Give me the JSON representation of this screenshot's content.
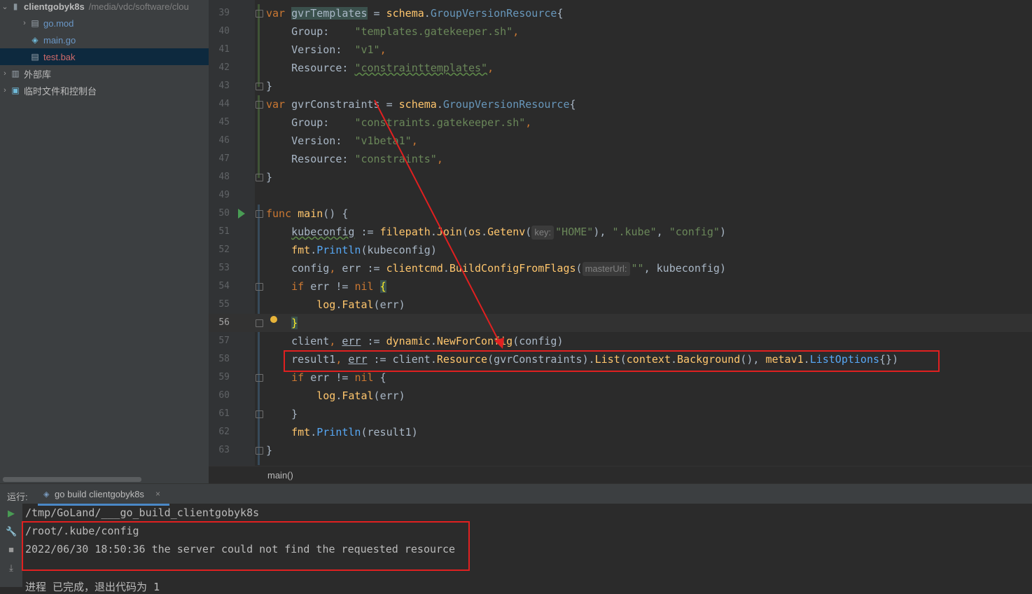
{
  "sidebar": {
    "project_name": "clientgobyk8s",
    "project_path": "/media/vdc/software/clou",
    "items": [
      {
        "label": "go.mod"
      },
      {
        "label": "main.go"
      },
      {
        "label": "test.bak"
      }
    ],
    "external_libs": "外部库",
    "scratches": "临时文件和控制台"
  },
  "editor": {
    "line_numbers": [
      "39",
      "40",
      "41",
      "42",
      "43",
      "44",
      "45",
      "46",
      "47",
      "48",
      "49",
      "50",
      "51",
      "52",
      "53",
      "54",
      "55",
      "56",
      "57",
      "58",
      "59",
      "60",
      "61",
      "62",
      "63"
    ],
    "current_line": "56",
    "code": {
      "l39": {
        "kw": "var",
        "name": "gvrTemplates",
        "eq": " = ",
        "pkg": "schema",
        "dot": ".",
        "type": "GroupVersionResource",
        "brace": "{"
      },
      "l40": {
        "key": "Group:",
        "val": "\"templates.gatekeeper.sh\"",
        "comma": ","
      },
      "l41": {
        "key": "Version:",
        "val": "\"v1\"",
        "comma": ","
      },
      "l42": {
        "key": "Resource:",
        "val": "\"constrainttemplates\"",
        "comma": ","
      },
      "l43": {
        "text": "}"
      },
      "l44": {
        "kw": "var",
        "name": "gvrConstraints",
        "eq": " = ",
        "pkg": "schema",
        "dot": ".",
        "type": "GroupVersionResource",
        "brace": "{"
      },
      "l45": {
        "key": "Group:",
        "val": "\"constraints.gatekeeper.sh\"",
        "comma": ","
      },
      "l46": {
        "key": "Version:",
        "val": "\"v1beta1\"",
        "comma": ","
      },
      "l47": {
        "key": "Resource:",
        "val": "\"constraints\"",
        "comma": ","
      },
      "l48": {
        "text": "}"
      },
      "l50": {
        "kw": "func",
        "name": "main",
        "rest": "() {"
      },
      "l51": {
        "v": "kubeconfig",
        "op": " := ",
        "pkg": "filepath",
        "fn": "Join",
        "pkg2": "os",
        "fn2": "Getenv",
        "hint": "key:",
        "s1": "\"HOME\"",
        "s2": "\".kube\"",
        "s3": "\"config\""
      },
      "l52": {
        "pkg": "fmt",
        "fn": "Println",
        "arg": "kubeconfig"
      },
      "l53": {
        "a": "config",
        "b": "err",
        "op": " := ",
        "pkg": "clientcmd",
        "fn": "BuildConfigFromFlags",
        "hint": "masterUrl:",
        "s": "\"\"",
        "arg": "kubeconfig"
      },
      "l54": {
        "kw": "if",
        "cond": " err != ",
        "nil": "nil",
        "brace": "{"
      },
      "l55": {
        "pkg": "log",
        "fn": "Fatal",
        "arg": "err"
      },
      "l56": {
        "brace": "}"
      },
      "l57": {
        "a": "client",
        "b": "err",
        "op": " := ",
        "pkg": "dynamic",
        "fn": "NewForConfig",
        "arg": "config"
      },
      "l58": {
        "a": "result1",
        "b": "err",
        "op": " := ",
        "obj": "client",
        "m1": "Resource",
        "arg1": "gvrConstraints",
        "m2": "List",
        "pkg": "context",
        "fn": "Background",
        "pkg2": "metav1",
        "type": "ListOptions"
      },
      "l59": {
        "kw": "if",
        "cond": " err != ",
        "nil": "nil",
        "brace": "{"
      },
      "l60": {
        "pkg": "log",
        "fn": "Fatal",
        "arg": "err"
      },
      "l61": {
        "text": "}"
      },
      "l62": {
        "pkg": "fmt",
        "fn": "Println",
        "arg": "result1"
      },
      "l63": {
        "text": "}"
      }
    },
    "breadcrumb": "main()"
  },
  "run": {
    "label": "运行:",
    "tab_label": "go build clientgobyk8s",
    "tab_close": "×",
    "output": [
      "/tmp/GoLand/___go_build_clientgobyk8s",
      "/root/.kube/config",
      "2022/06/30 18:50:36 the server could not find the requested resource",
      "进程 已完成，退出代码为 1"
    ]
  },
  "colors": {
    "annotation_red": "#e02020",
    "keyword": "#cc7832",
    "string": "#6a8759",
    "function": "#ffc66d"
  }
}
